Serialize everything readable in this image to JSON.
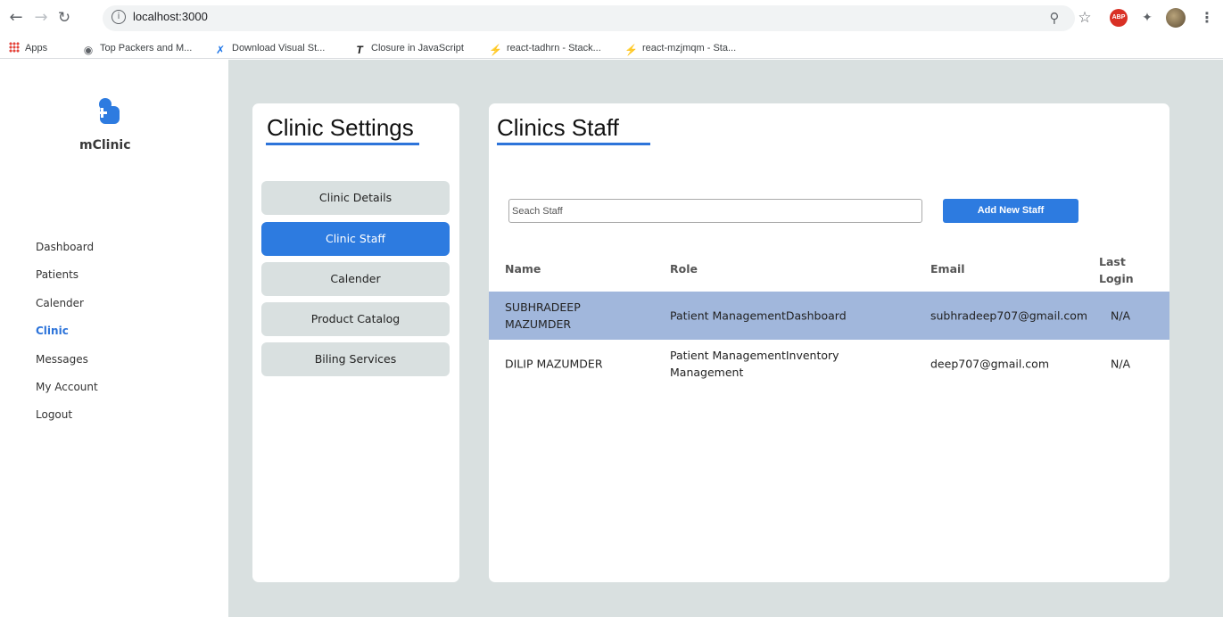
{
  "browser": {
    "url": "localhost:3000",
    "bookmarks": [
      {
        "label": "Apps",
        "icon": "apps-grid-icon"
      },
      {
        "label": "Top Packers and M...",
        "icon": "globe-icon"
      },
      {
        "label": "Download Visual St...",
        "icon": "vscode-icon"
      },
      {
        "label": "Closure in JavaScript",
        "icon": "t-logo-icon"
      },
      {
        "label": "react-tadhrn - Stack...",
        "icon": "bolt-icon"
      },
      {
        "label": "react-mzjmqm - Sta...",
        "icon": "bolt-icon"
      }
    ],
    "extension_abp": "ABP"
  },
  "brand": {
    "name": "mClinic"
  },
  "sidebar": {
    "items": [
      {
        "label": "Dashboard"
      },
      {
        "label": "Patients"
      },
      {
        "label": "Calender"
      },
      {
        "label": "Clinic",
        "active": true
      },
      {
        "label": "Messages"
      },
      {
        "label": "My Account"
      },
      {
        "label": "Logout"
      }
    ]
  },
  "settings": {
    "title": "Clinic Settings",
    "buttons": [
      {
        "label": "Clinic Details"
      },
      {
        "label": "Clinic Staff",
        "active": true
      },
      {
        "label": "Calender"
      },
      {
        "label": "Product Catalog"
      },
      {
        "label": "Biling Services"
      }
    ]
  },
  "staff": {
    "title": "Clinics Staff",
    "search_placeholder": "Seach Staff",
    "add_button": "Add New Staff",
    "columns": {
      "name": "Name",
      "role": "Role",
      "email": "Email",
      "last_login": "Last Login"
    },
    "rows": [
      {
        "name": "SUBHRADEEP MAZUMDER",
        "role": "Patient ManagementDashboard",
        "email": "subhradeep707@gmail.com",
        "last_login": "N/A",
        "selected": true
      },
      {
        "name": "DILIP MAZUMDER",
        "role": "Patient ManagementInventory Management",
        "email": "deep707@gmail.com",
        "last_login": "N/A",
        "selected": false
      }
    ]
  },
  "colors": {
    "accent": "#2d7be0",
    "selected_row": "#a1b7dc",
    "background": "#d9e0e0"
  }
}
